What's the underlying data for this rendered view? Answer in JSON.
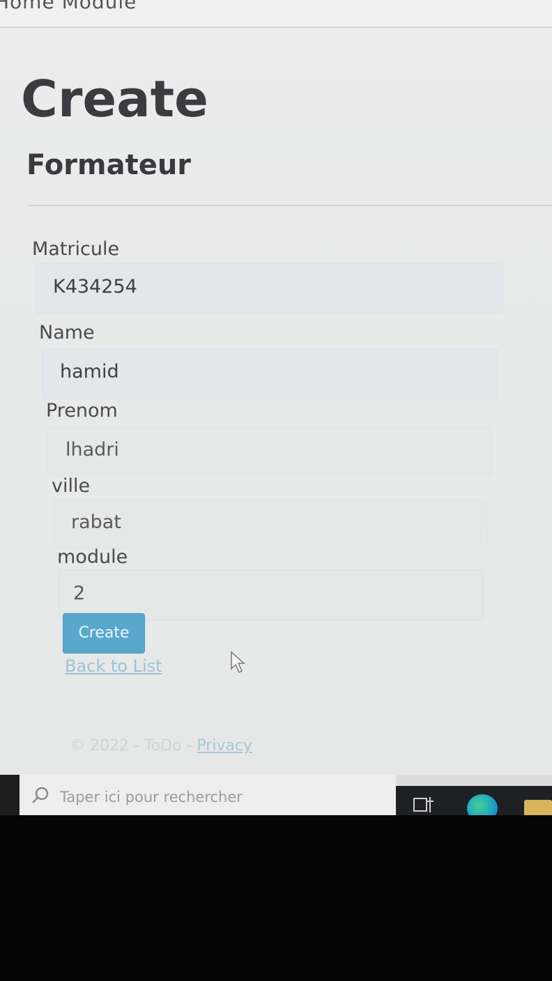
{
  "nav": {
    "text": "Home   Module"
  },
  "page": {
    "title": "Create",
    "subtitle": "Formateur"
  },
  "form": {
    "fields": [
      {
        "label": "Matricule",
        "value": "K434254"
      },
      {
        "label": "Name",
        "value": "hamid"
      },
      {
        "label": "Prenom",
        "value": "lhadri"
      },
      {
        "label": "ville",
        "value": "rabat"
      },
      {
        "label": "module",
        "value": "2"
      }
    ],
    "submit_label": "Create",
    "back_label": "Back to List"
  },
  "footer": {
    "copyright": "© 2022 - ToDo - ",
    "privacy": "Privacy"
  },
  "taskbar": {
    "search_placeholder": "Taper ici pour rechercher"
  },
  "colors": {
    "button": "#58a8cc",
    "link": "#9cc3d7",
    "heading": "#3c3c40"
  }
}
